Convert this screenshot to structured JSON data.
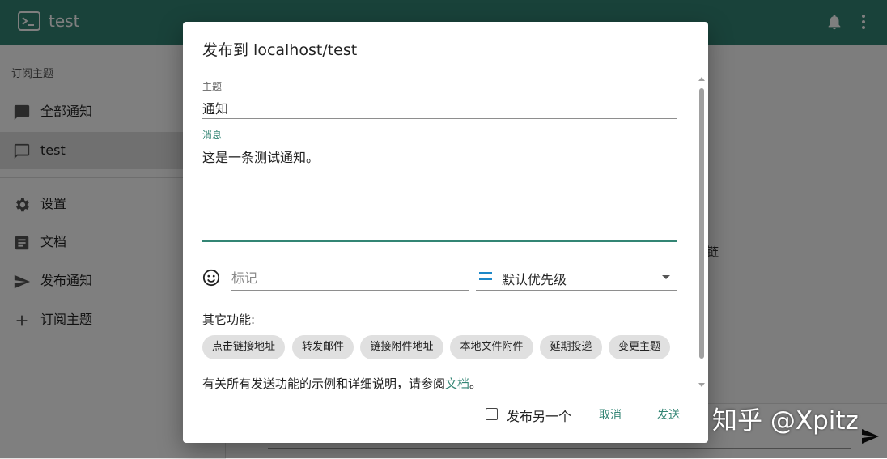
{
  "app": {
    "title": "test",
    "logo_icon": "terminal-icon",
    "header_icons": [
      "bell-icon",
      "more-vert-icon"
    ],
    "accent": "#338574"
  },
  "sidebar": {
    "section_title": "订阅主题",
    "items": [
      {
        "label": "全部通知",
        "icon": "chat-icon"
      },
      {
        "label": "test",
        "icon": "chat-outline-icon",
        "active": true
      },
      {
        "label": "设置",
        "icon": "gear-icon"
      },
      {
        "label": "文档",
        "icon": "article-icon"
      },
      {
        "label": "发布通知",
        "icon": "send-icon"
      },
      {
        "label": "订阅主题",
        "icon": "plus-icon"
      }
    ]
  },
  "background": {
    "partial_text": "链"
  },
  "dialog": {
    "title": "发布到 localhost/test",
    "topic": {
      "label": "主题",
      "value": "通知"
    },
    "message": {
      "label": "消息",
      "value": "这是一条测试通知。"
    },
    "tags": {
      "placeholder": "标记",
      "icon": "emoji-icon"
    },
    "priority": {
      "value": "默认优先级",
      "icon": "priority-default-icon"
    },
    "other_features_label": "其它功能:",
    "chips": [
      "点击链接地址",
      "转发邮件",
      "链接附件地址",
      "本地文件附件",
      "延期投递",
      "变更主题"
    ],
    "help_text_prefix": "有关所有发送功能的示例和详细说明，请参阅",
    "help_link": "文档",
    "help_text_suffix": "。",
    "publish_another_label": "发布另一个",
    "cancel_label": "取消",
    "send_label": "发送"
  },
  "watermark": "知乎 @Xpitz"
}
